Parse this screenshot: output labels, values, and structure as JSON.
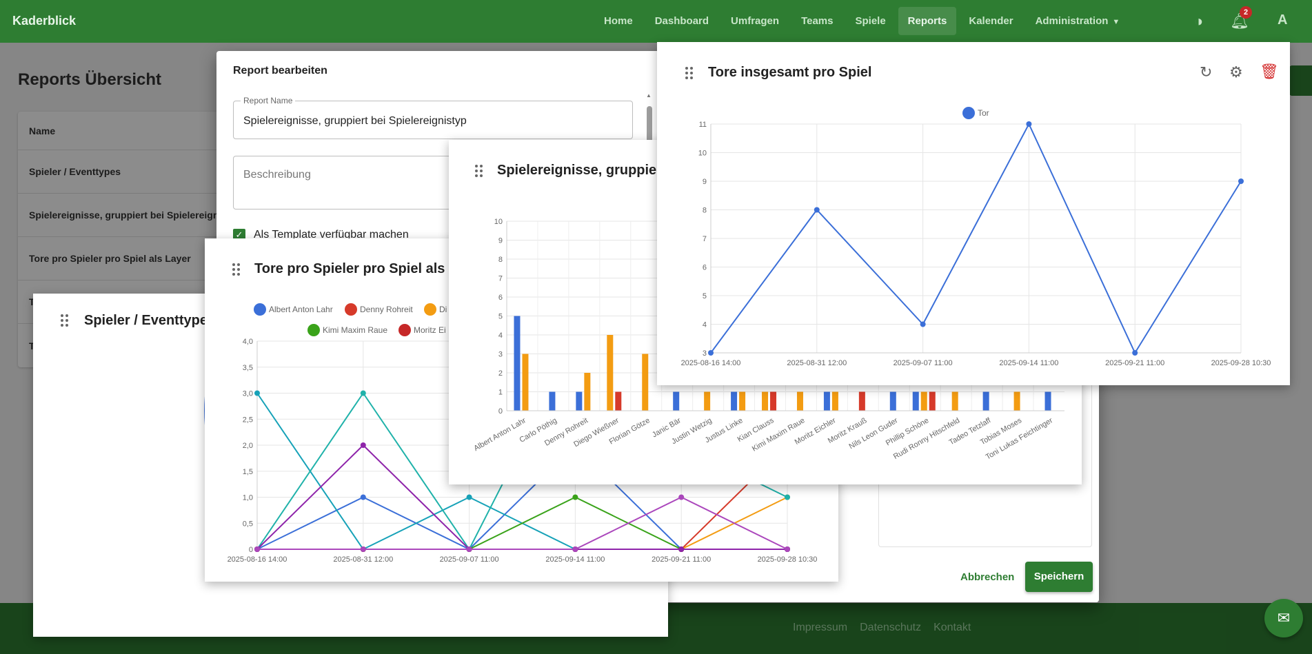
{
  "app": {
    "brand": "Kaderblick",
    "nav": [
      {
        "label": "Home"
      },
      {
        "label": "Dashboard"
      },
      {
        "label": "Umfragen"
      },
      {
        "label": "Teams"
      },
      {
        "label": "Spiele"
      },
      {
        "label": "Reports",
        "active": true
      },
      {
        "label": "Kalender"
      },
      {
        "label": "Administration",
        "dropdown": true
      }
    ],
    "notification_count": "2",
    "avatar_letter": "A",
    "theme_icon": "brightness-icon",
    "bell_icon": "bell-icon"
  },
  "page": {
    "title": "Reports Übersicht",
    "list_header": "Name",
    "list_items": [
      "Spieler / Eventtypes",
      "Spielereignisse, gruppiert bei Spielereignistyp",
      "Tore pro Spieler pro Spiel als Layer",
      "T",
      "T"
    ]
  },
  "footer": {
    "links": [
      "Impressum",
      "Datenschutz",
      "Kontakt"
    ]
  },
  "dialog": {
    "title": "Report bearbeiten",
    "name_label": "Report Name",
    "name_value": "Spielereignisse, gruppiert bei Spielereignistyp",
    "description_placeholder": "Beschreibung",
    "template_checkbox_label": "Als Template verfügbar machen",
    "cancel_label": "Abbrechen",
    "save_label": "Speichern"
  },
  "widgets": {
    "tore_gesamt": {
      "title": "Tore insgesamt pro Spiel"
    },
    "spielereignisse": {
      "title": "Spielereignisse, gruppiert"
    },
    "tore_spieler": {
      "title": "Tore pro Spieler pro Spiel als La"
    },
    "spieler_eventtypes": {
      "title": "Spieler / Eventtypes"
    }
  },
  "chart_data": [
    {
      "id": "tore_gesamt",
      "type": "line",
      "title": "Tore insgesamt pro Spiel",
      "x": [
        "2025-08-16 14:00",
        "2025-08-31 12:00",
        "2025-09-07 11:00",
        "2025-09-14 11:00",
        "2025-09-21 11:00",
        "2025-09-28 10:30"
      ],
      "series": [
        {
          "name": "Tor",
          "color": "#3b6fd8",
          "values": [
            3,
            8,
            4,
            11,
            3,
            9
          ]
        }
      ],
      "ylim": [
        3,
        11
      ],
      "yticks": [
        "3",
        "4",
        "5",
        "6",
        "7",
        "8",
        "9",
        "10",
        "11"
      ],
      "grid": true,
      "legend": "top"
    },
    {
      "id": "spielereignisse",
      "type": "bar",
      "title": "Spielereignisse, gruppiert",
      "categories": [
        "Albert Anton Lahr",
        "Carlo Pöthig",
        "Denny Rohreit",
        "Diego Wießner",
        "Florian Götze",
        "Janic Bär",
        "Justin Wetzig",
        "Justus Linke",
        "Kian Clauss",
        "Kimi Maxim Raue",
        "Moritz Eichler",
        "Moritz Krauß",
        "Nils Leon Guder",
        "Phillip Schöne",
        "Rudi Ronny Hitschfeld",
        "Tadeo Tetzlaff",
        "Tobias Moses",
        "Toni Lukas Feichtinger"
      ],
      "series": [
        {
          "color": "#3b6fd8",
          "values": [
            5,
            1,
            1,
            0,
            0,
            1,
            0,
            1,
            0,
            0,
            1,
            0,
            1,
            1,
            0,
            1,
            0,
            1
          ]
        },
        {
          "color": "#f39c12",
          "values": [
            3,
            0,
            2,
            4,
            3,
            0,
            1,
            1,
            1,
            1,
            1,
            0,
            0,
            1,
            1,
            0,
            1,
            0
          ]
        },
        {
          "color": "#d63a2a",
          "values": [
            0,
            0,
            0,
            1,
            0,
            0,
            0,
            0,
            1,
            0,
            0,
            1,
            0,
            1,
            0,
            0,
            0,
            0
          ]
        }
      ],
      "ylim": [
        0,
        10
      ],
      "yticks": [
        "0",
        "1",
        "2",
        "3",
        "4",
        "5",
        "6",
        "7",
        "8",
        "9",
        "10"
      ],
      "grid": true
    },
    {
      "id": "tore_spieler",
      "type": "line",
      "title": "Tore pro Spieler pro Spiel als La",
      "x": [
        "2025-08-16 14:00",
        "2025-08-31 12:00",
        "2025-09-07 11:00",
        "2025-09-14 11:00",
        "2025-09-21 11:00",
        "2025-09-28 10:30"
      ],
      "series": [
        {
          "name": "Albert Anton Lahr",
          "color": "#3b6fd8",
          "values": [
            0,
            1,
            0,
            2,
            0,
            0
          ]
        },
        {
          "name": "Denny Rohreit",
          "color": "#d63a2a",
          "values": [
            0,
            0,
            0,
            0,
            0,
            2
          ]
        },
        {
          "name": "Di",
          "color": "#f39c12",
          "values": [
            0,
            0,
            0,
            0,
            0,
            1
          ]
        },
        {
          "name": "",
          "color": "#17a2b8",
          "values": [
            3,
            0,
            1,
            0,
            0,
            0
          ]
        },
        {
          "name": "",
          "color": "#20b2aa",
          "values": [
            0,
            3,
            0,
            4,
            2,
            1
          ]
        },
        {
          "name": "Kimi Maxim Raue",
          "color": "#3aa31a",
          "values": [
            0,
            0,
            0,
            1,
            0,
            0
          ]
        },
        {
          "name": "Moritz Ei",
          "color": "#c62828",
          "values": [
            0,
            0,
            0,
            0,
            0,
            0
          ]
        },
        {
          "name": "",
          "color": "#8e24aa",
          "values": [
            0,
            2,
            0,
            0,
            0,
            0
          ]
        },
        {
          "name": "",
          "color": "#ab47bc",
          "values": [
            0,
            0,
            0,
            0,
            1,
            0
          ]
        }
      ],
      "ylim": [
        0,
        4
      ],
      "yticks": [
        "0",
        "0,5",
        "1,0",
        "1,5",
        "2,0",
        "2,5",
        "3,0",
        "3,5",
        "4,0"
      ],
      "grid": true,
      "legend": "top"
    },
    {
      "id": "spieler_eventtypes",
      "type": "pie",
      "title": "Spieler / Eventtypes",
      "rings": [
        {
          "color": "#3b6fd8"
        },
        {
          "color": "#f39c12"
        }
      ]
    }
  ]
}
